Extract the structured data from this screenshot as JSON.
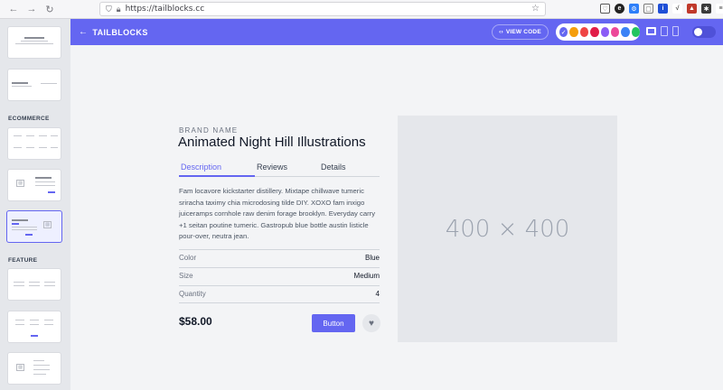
{
  "browser": {
    "url": "https://tailblocks.cc",
    "back_icon": "arrow-left-icon",
    "forward_icon": "arrow-right-icon",
    "reload_icon": "reload-icon"
  },
  "header": {
    "brand": "TAILBLOCKS",
    "view_code": "VIEW CODE",
    "accent": "#6466f1",
    "theme_colors": [
      "#6466f1",
      "#f59e0b",
      "#ef4444",
      "#e11d48",
      "#8b5cf6",
      "#ec4899",
      "#3b82f6",
      "#22c55e"
    ]
  },
  "sidebar": {
    "sections": [
      {
        "label": "ECOMMERCE"
      },
      {
        "label": "FEATURE"
      }
    ]
  },
  "product": {
    "brand_name": "BRAND NAME",
    "title": "Animated Night Hill Illustrations",
    "tabs": [
      {
        "label": "Description"
      },
      {
        "label": "Reviews"
      },
      {
        "label": "Details"
      }
    ],
    "description": "Fam locavore kickstarter distillery. Mixtape chillwave tumeric sriracha taximy chia microdosing tilde DIY. XOXO fam inxigo juiceramps cornhole raw denim forage brooklyn. Everyday carry +1 seitan poutine tumeric. Gastropub blue bottle austin listicle pour-over, neutra jean.",
    "specs": [
      {
        "label": "Color",
        "value": "Blue"
      },
      {
        "label": "Size",
        "value": "Medium"
      },
      {
        "label": "Quantity",
        "value": "4"
      }
    ],
    "price": "$58.00",
    "button": "Button",
    "image_placeholder": "400 × 400"
  }
}
